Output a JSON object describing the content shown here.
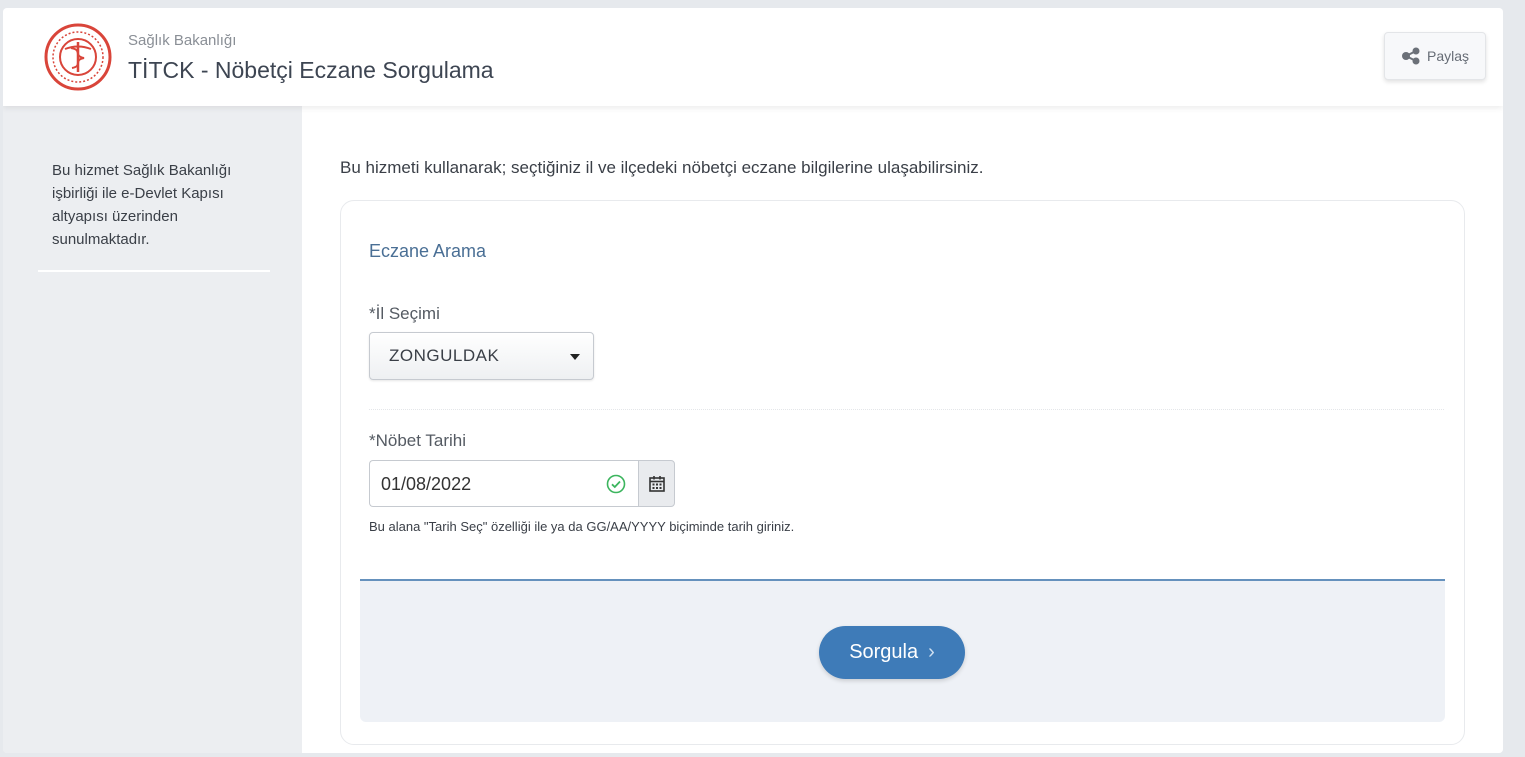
{
  "header": {
    "org_name": "Sağlık Bakanlığı",
    "title": "TİTCK - Nöbetçi Eczane Sorgulama",
    "logo_icon": "ministry-health-logo",
    "share_label": "Paylaş",
    "share_icon": "share-icon"
  },
  "sidebar": {
    "text": "Bu hizmet Sağlık Bakanlığı işbirliği ile e-Devlet Kapısı altyapısı üzerinden sunulmaktadır."
  },
  "main": {
    "intro": "Bu hizmeti kullanarak; seçtiğiniz il ve ilçedeki nöbetçi eczane bilgilerine ulaşabilirsiniz.",
    "card_title": "Eczane Arama",
    "province": {
      "label": "*İl Seçimi",
      "selected": "ZONGULDAK"
    },
    "date": {
      "label": "*Nöbet Tarihi",
      "value": "01/08/2022",
      "hint": "Bu alana \"Tarih Seç\" özelliği ile ya da GG/AA/YYYY biçiminde tarih giriniz."
    },
    "submit_label": "Sorgula",
    "submit_chevron": "›"
  },
  "colors": {
    "accent": "#3e7bb8",
    "brand_red": "#d9453a",
    "valid_green": "#3cb55e"
  }
}
